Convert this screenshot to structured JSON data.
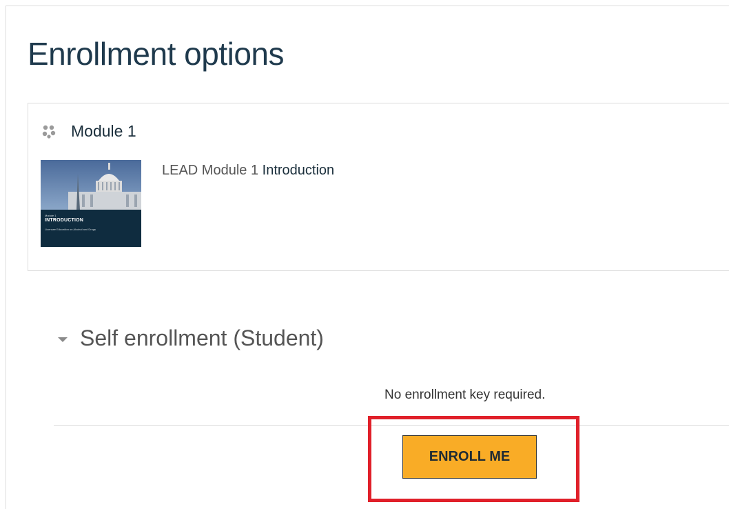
{
  "page": {
    "title": "Enrollment options"
  },
  "course": {
    "name": "Module 1",
    "summary_prefix": "LEAD Module 1 ",
    "summary_link": "Introduction",
    "thumbnail": {
      "small_label": "Module 1",
      "big_label": "INTRODUCTION",
      "sub_label": "Licensee Education on Alcohol and Drugs"
    }
  },
  "enrolment": {
    "section_title": "Self enrollment (Student)",
    "key_note": "No enrollment key required.",
    "button_label": "ENROLL ME"
  },
  "colors": {
    "title": "#1f3a4d",
    "button_bg": "#f9ac26",
    "highlight": "#e0202a",
    "thumb_bg": "#0f2c3f"
  },
  "icons": {
    "course": "course-cluster-icon",
    "caret": "caret-down-icon"
  }
}
